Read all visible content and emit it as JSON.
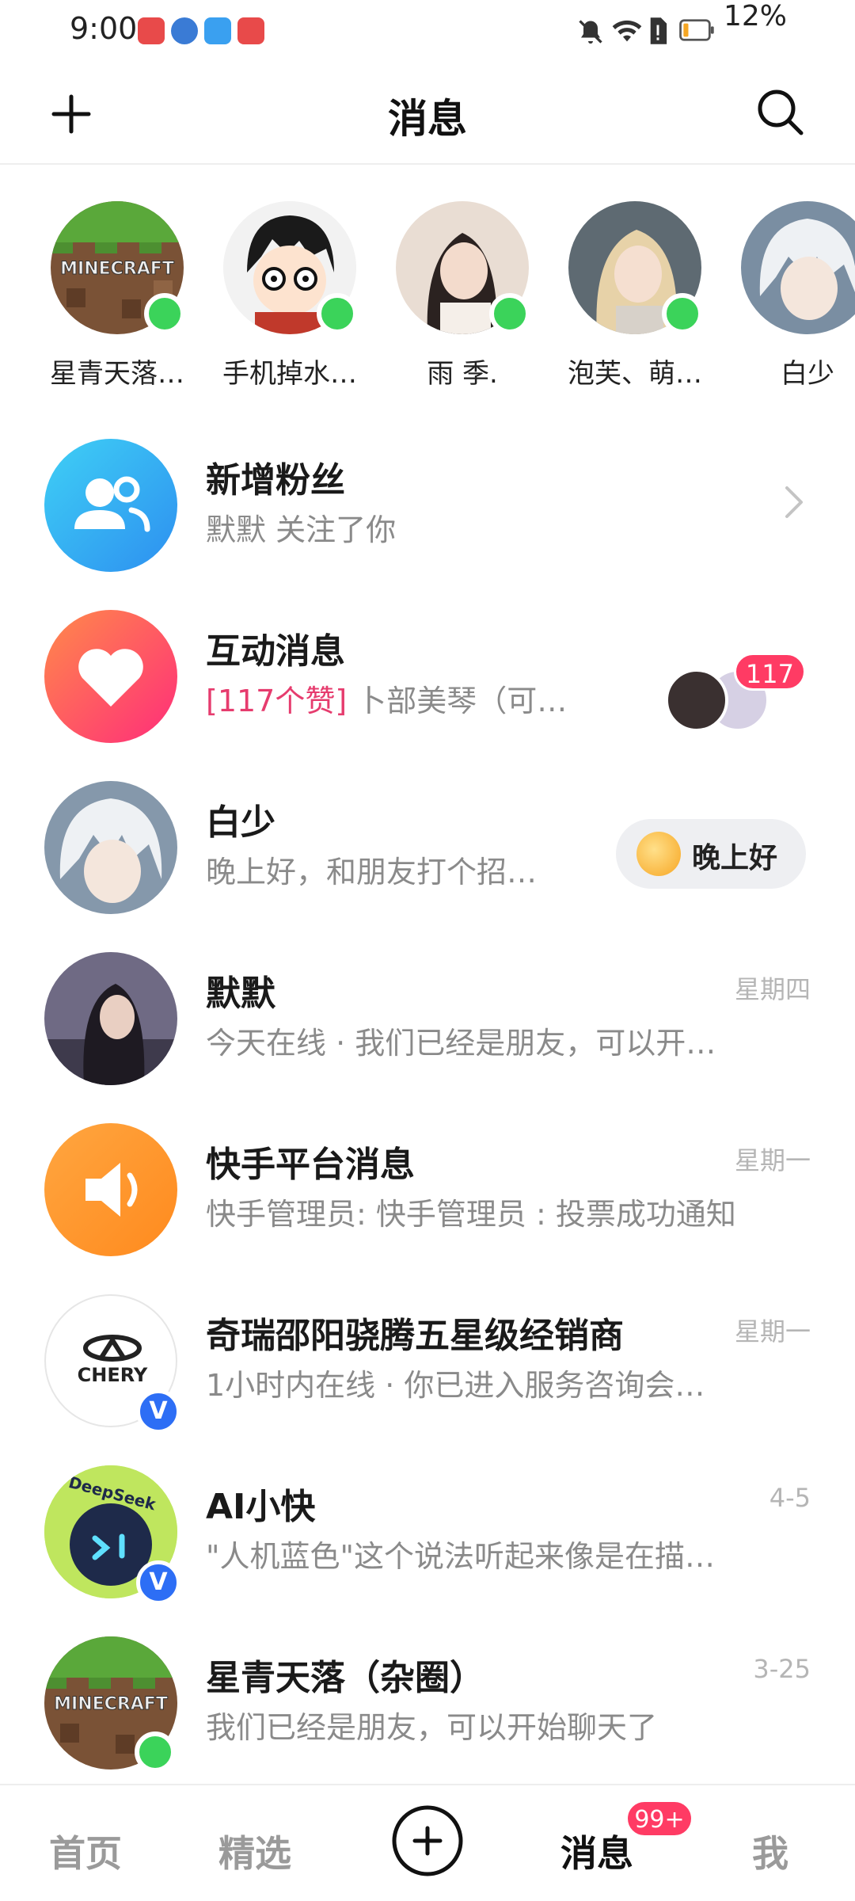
{
  "status_bar": {
    "time": "9:00",
    "battery_percent": "12%",
    "icons": [
      "huawei-appgallery-icon",
      "browser-icon",
      "weather-icon",
      "huawei-store-icon",
      "bell-muted-icon",
      "wifi-icon",
      "sim-icon",
      "battery-low-icon"
    ]
  },
  "header": {
    "title": "消息",
    "left_icon": "plus-icon",
    "right_icon": "search-icon"
  },
  "stories": [
    {
      "name": "星青天落…",
      "online": true
    },
    {
      "name": "手机掉水…",
      "online": true
    },
    {
      "name": "雨 季.",
      "online": true
    },
    {
      "name": "泡芙、萌…",
      "online": true
    },
    {
      "name": "白少",
      "online": false
    }
  ],
  "conversations": [
    {
      "title": "新增粉丝",
      "preview": "默默 关注了你",
      "time": "",
      "icon": "new-fans-icon"
    },
    {
      "title": "互动消息",
      "preview_highlight": "[117个赞]",
      "preview": " 卜部美琴（可…",
      "badge": "117",
      "icon": "heart-icon"
    },
    {
      "title": "白少",
      "preview": "晚上好，和朋友打个招…",
      "action_label": "晚上好"
    },
    {
      "title": "默默",
      "preview": "今天在线 · 我们已经是朋友，可以开…",
      "time": "星期四"
    },
    {
      "title": "快手平台消息",
      "preview": "快手管理员: 快手管理员 : 投票成功通知",
      "time": "星期一",
      "icon": "speaker-icon"
    },
    {
      "title": "奇瑞邵阳骁腾五星级经销商",
      "preview": "1小时内在线 · 你已进入服务咨询会…",
      "time": "星期一",
      "logo_text": "CHERY",
      "verified": "V"
    },
    {
      "title": "AI小快",
      "preview": "\"人机蓝色\"这个说法听起来像是在描…",
      "time": "4-5",
      "logo_text": "DeepSeek",
      "verified": "V"
    },
    {
      "title": "星青天落（杂圈）",
      "preview": "我们已经是朋友，可以开始聊天了",
      "time": "3-25"
    }
  ],
  "bottom_nav": {
    "items": [
      "首页",
      "精选",
      "消息",
      "我"
    ],
    "active": "消息",
    "badge": "99+"
  },
  "minecraft_text": "MINECRAFT",
  "colors": {
    "accent_pink": "#ff3b64",
    "online_green": "#3bd35a",
    "verified_blue": "#2d6ef5"
  }
}
